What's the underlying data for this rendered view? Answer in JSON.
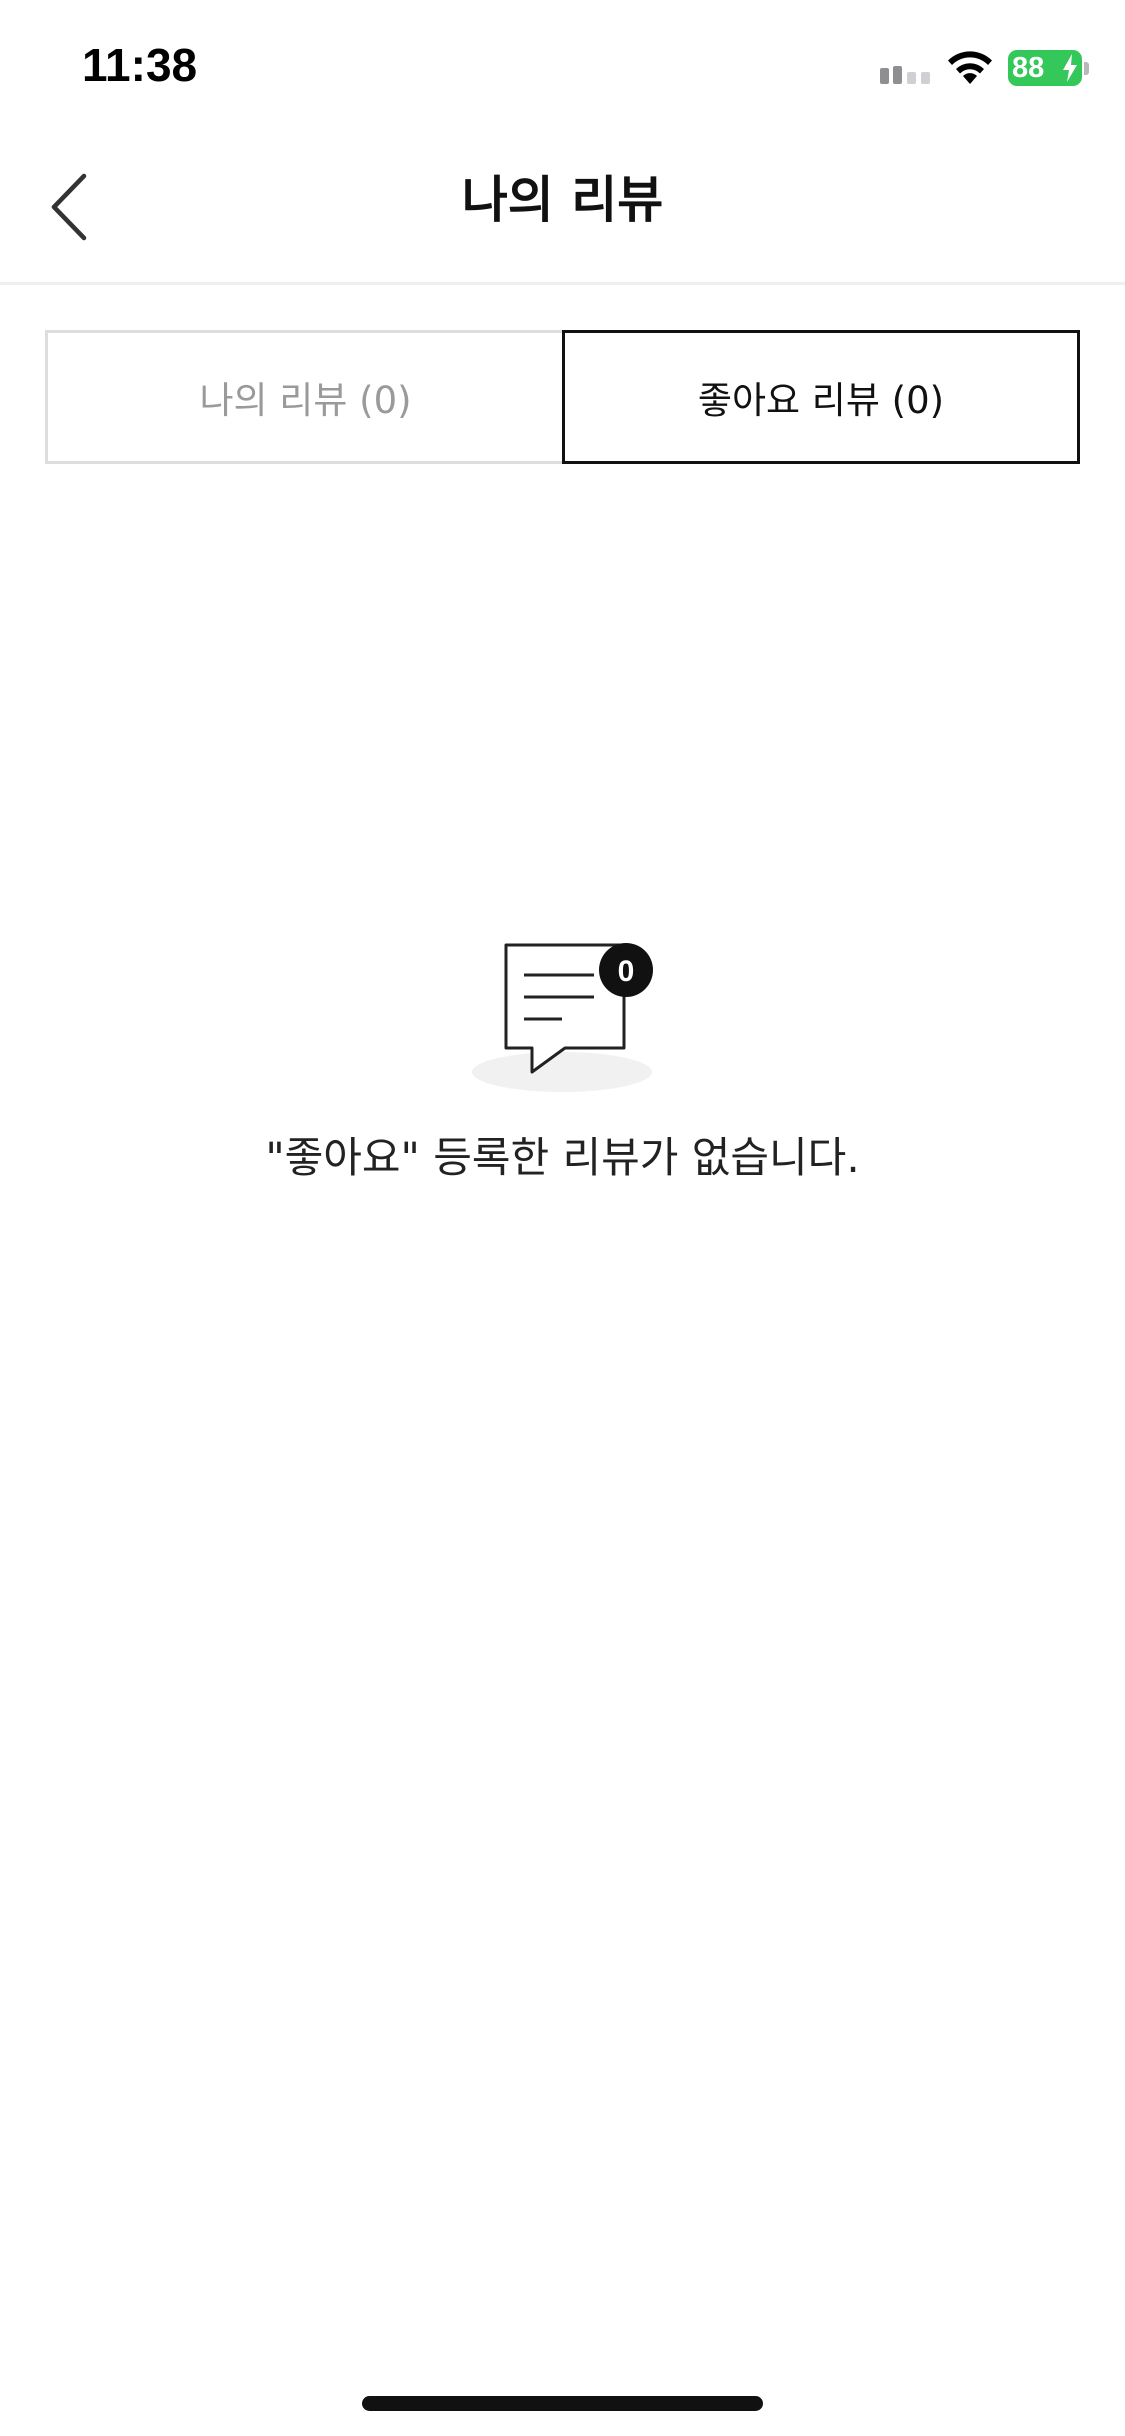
{
  "status_bar": {
    "time": "11:38",
    "battery_level": "88",
    "icons": [
      "signal-icon",
      "wifi-icon",
      "battery-charging-icon"
    ]
  },
  "header": {
    "back_icon": "chevron-left-icon",
    "title": "나의 리뷰"
  },
  "tabs": [
    {
      "label": "나의 리뷰 (0)",
      "selected": false
    },
    {
      "label": "좋아요 리뷰 (0)",
      "selected": true
    }
  ],
  "empty_state": {
    "icon": "speech-bubble-icon",
    "badge_count": "0",
    "message": "\"좋아요\" 등록한 리뷰가 없습니다."
  },
  "colors": {
    "selected_border": "#111111",
    "unselected_border": "#dddddd",
    "unselected_text": "#9a9a9a",
    "battery_green": "#34c759"
  }
}
